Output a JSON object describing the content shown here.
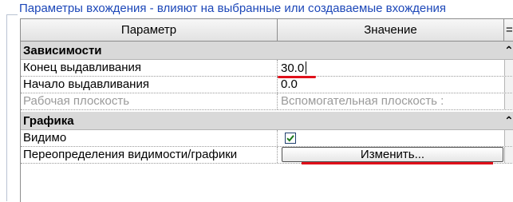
{
  "group": {
    "title": "Параметры вхождения - влияют на выбранные или создаваемые вхождения"
  },
  "grid": {
    "headers": {
      "parameter": "Параметр",
      "value": "Значение",
      "extra": "="
    },
    "sections": [
      {
        "title": "Зависимости",
        "toggle": "⌃",
        "rows": [
          {
            "name": "Конец выдавливания",
            "value": "30.0"
          },
          {
            "name": "Начало выдавливания",
            "value": "0.0"
          },
          {
            "name": "Рабочая плоскость",
            "value": "Вспомогательная плоскость :"
          }
        ]
      },
      {
        "title": "Графика",
        "toggle": "⌃",
        "rows": [
          {
            "name": "Видимо",
            "checked": true
          },
          {
            "name": "Переопределения видимости/графики",
            "button": "Изменить..."
          }
        ]
      }
    ]
  },
  "colors": {
    "accent_blue": "#1c47b8",
    "highlight_red": "#e0101a",
    "check_green": "#1d7a1d"
  }
}
